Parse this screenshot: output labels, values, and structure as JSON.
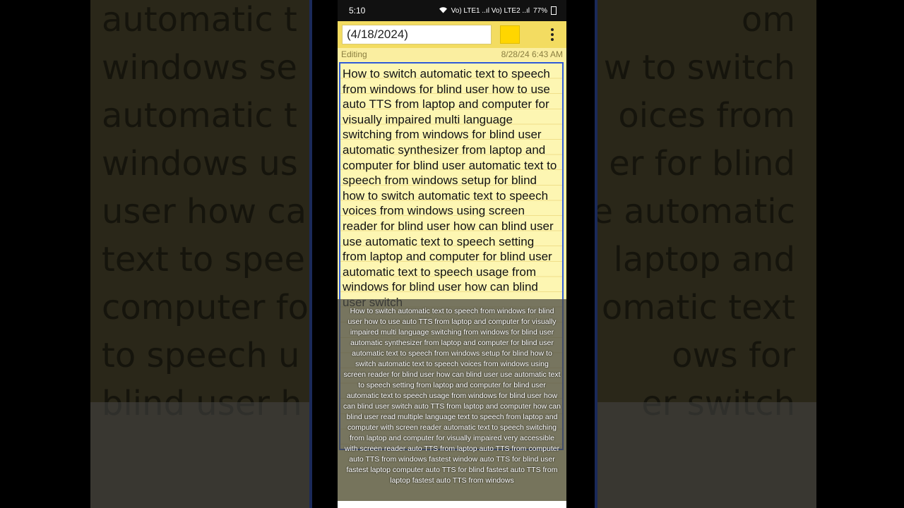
{
  "status_bar": {
    "time": "5:10",
    "battery": "77%",
    "signal": "Vo) LTE1 ..ıl Vo) LTE2 ..ıl"
  },
  "toolbar": {
    "title_value": "(4/18/2024)",
    "note_color": "#ffd600"
  },
  "meta": {
    "mode": "Editing",
    "timestamp": "8/28/24 6:43 AM"
  },
  "note": {
    "body": "How to switch automatic text to speech from windows for blind user how to use auto TTS from laptop and computer for visually impaired multi language switching from windows for blind user automatic synthesizer from laptop and computer for blind user automatic text to speech from windows setup for blind how to switch automatic text to speech voices from windows using screen reader for blind user how can blind user use automatic text to speech setting from laptop and computer for blind user automatic text to speech usage from windows for blind user how can blind user switch"
  },
  "caption": {
    "text": "How to switch automatic text to speech from windows for blind user how to use auto TTS from laptop and computer for visually impaired multi language switching from windows for blind user automatic synthesizer from laptop and computer for blind user automatic text to speech from windows setup for blind how to switch automatic text to speech voices from windows using screen reader for blind user how can blind user use automatic text to speech setting from laptop and computer for blind user automatic text to speech usage from windows for blind user how can blind user switch auto TTS from laptop and computer how can blind user read multiple language text to speech from laptop and computer with screen reader automatic text to speech switching from laptop and computer for visually impaired very accessible with screen reader auto TTS from laptop auto TTS  from computer auto TTS from windows  fastest window auto TTS for blind user fastest laptop computer auto TTS for blind fastest auto TTS from laptop fastest auto TTS from windows"
  },
  "background": {
    "left_text": "automatic t\nwindows se\nautomatic t\nwindows us\nuser how ca\ntext to spee\ncomputer fo\nto speech u\nblind user h",
    "right_text": "om\nw to switch\noices from\ner for blind\ne automatic\nlaptop and\nomatic text\nows for\ner switch"
  }
}
